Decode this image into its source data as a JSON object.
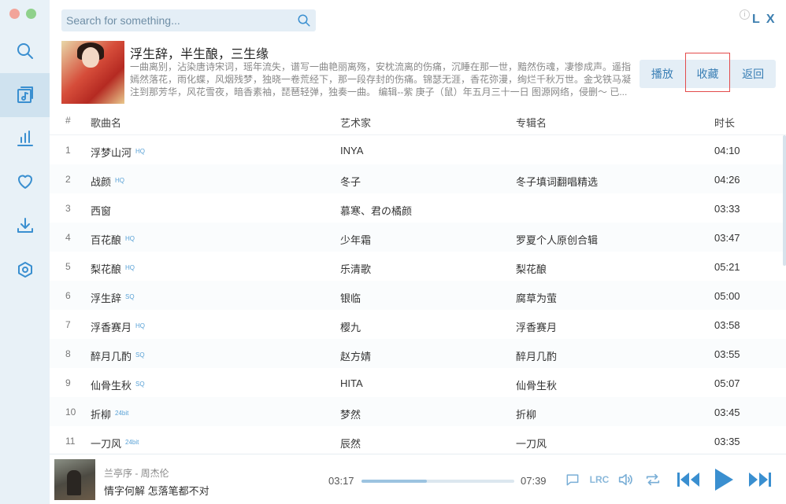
{
  "sidebar": {
    "nav": [
      "search-icon",
      "playlist-icon",
      "chart-icon",
      "heart-icon",
      "download-icon",
      "settings-icon"
    ],
    "active_index": 1
  },
  "header": {
    "search_placeholder": "Search for something...",
    "logo": "L X"
  },
  "playlist": {
    "title": "浮生辞，半生酿，三生缘",
    "description": "一曲离别，沾染唐诗宋词，瑶年流失，谱写一曲艳丽离殇，安枕流离的伤痛，沉睡在那一世，黯然伤魂，凄惨成声。遥指嫣然落花，雨化蝶，风烟残梦，独晓一卷荒经下，那一段存封的伤痛。锦瑟无涯，香花弥漫，绚烂千秋万世。金戈铁马凝注到那芳华，风花雪夜，暗香素袖，琵琶轻弹，独奏一曲。 编辑--紫 庚子（鼠）年五月三十一日 图源网络，侵删～ 已...",
    "buttons": {
      "play": "播放",
      "collect": "收藏",
      "back": "返回"
    }
  },
  "table": {
    "headers": {
      "num": "#",
      "name": "歌曲名",
      "artist": "艺术家",
      "album": "专辑名",
      "duration": "时长"
    },
    "rows": [
      {
        "num": "1",
        "name": "浮梦山河",
        "tag": "HQ",
        "artist": "INYA",
        "album": "",
        "duration": "04:10"
      },
      {
        "num": "2",
        "name": "战颜",
        "tag": "HQ",
        "artist": "冬子",
        "album": "冬子填词翻唱精选",
        "duration": "04:26"
      },
      {
        "num": "3",
        "name": "西窗",
        "tag": "",
        "artist": "慕寒、君の橘颜",
        "album": "",
        "duration": "03:33"
      },
      {
        "num": "4",
        "name": "百花酿",
        "tag": "HQ",
        "artist": "少年霜",
        "album": "罗夏个人原创合辑",
        "duration": "03:47"
      },
      {
        "num": "5",
        "name": "梨花酿",
        "tag": "HQ",
        "artist": "乐清歌",
        "album": "梨花酿",
        "duration": "05:21"
      },
      {
        "num": "6",
        "name": "浮生辞",
        "tag": "SQ",
        "artist": "银临",
        "album": "腐草为萤",
        "duration": "05:00"
      },
      {
        "num": "7",
        "name": "浮香赛月",
        "tag": "HQ",
        "artist": "樱九",
        "album": "浮香赛月",
        "duration": "03:58"
      },
      {
        "num": "8",
        "name": "醉月几酌",
        "tag": "SQ",
        "artist": "赵方婧",
        "album": "醉月几酌",
        "duration": "03:55"
      },
      {
        "num": "9",
        "name": "仙骨生秋",
        "tag": "SQ",
        "artist": "HITA",
        "album": "仙骨生秋",
        "duration": "05:07"
      },
      {
        "num": "10",
        "name": "折柳",
        "tag": "24bit",
        "artist": "梦然",
        "album": "折柳",
        "duration": "03:45"
      },
      {
        "num": "11",
        "name": "一刀风",
        "tag": "24bit",
        "artist": "辰然",
        "album": "一刀风",
        "duration": "03:35"
      }
    ]
  },
  "player": {
    "song": "兰亭序 - 周杰伦",
    "lyric": "情字何解 怎落笔都不对",
    "current_time": "03:17",
    "total_time": "07:39",
    "progress": 0.43,
    "lrc_label": "LRC"
  },
  "colors": {
    "accent": "#3a8fd0",
    "sidebar_bg": "#e8f1f7",
    "button_bg": "#e4eef6"
  }
}
